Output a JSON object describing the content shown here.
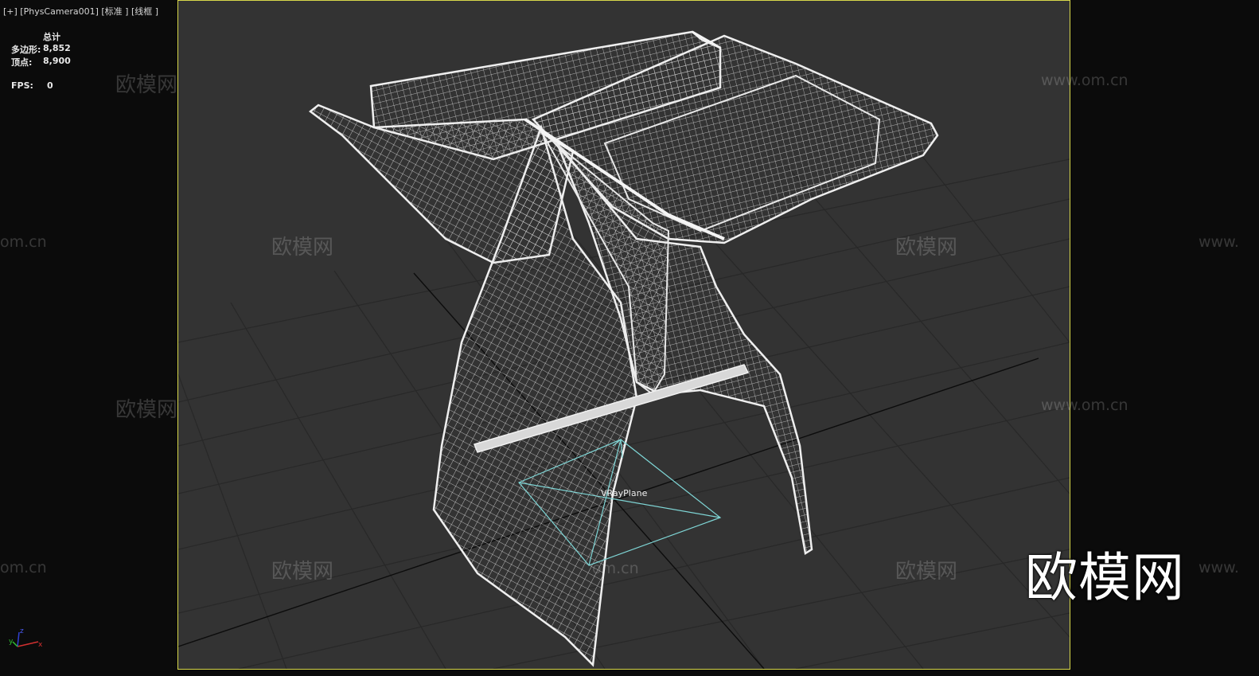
{
  "viewport": {
    "label": "[+] [PhysCamera001] [标准 ] [线框 ]"
  },
  "stats": {
    "title": "总计",
    "polygons_label": "多边形:",
    "polygons_value": "8,852",
    "vertices_label": "顶点:",
    "vertices_value": "8,900",
    "fps_label": "FPS:",
    "fps_value": "0"
  },
  "scene": {
    "vray_plane_label": "VRayPlane",
    "axes": {
      "x": "x",
      "y": "y",
      "z": "z"
    }
  },
  "watermarks": {
    "cn": "欧模网",
    "url": "www.om.cn",
    "url_partial": "om.cn",
    "url_left": "www.",
    "brand": "欧模网"
  },
  "colors": {
    "viewport_bg": "#333333",
    "frame_border": "#d8d84a",
    "wireframe": "#e6e6e6",
    "grid": "#262626",
    "vray_plane": "#7fd6d6"
  }
}
